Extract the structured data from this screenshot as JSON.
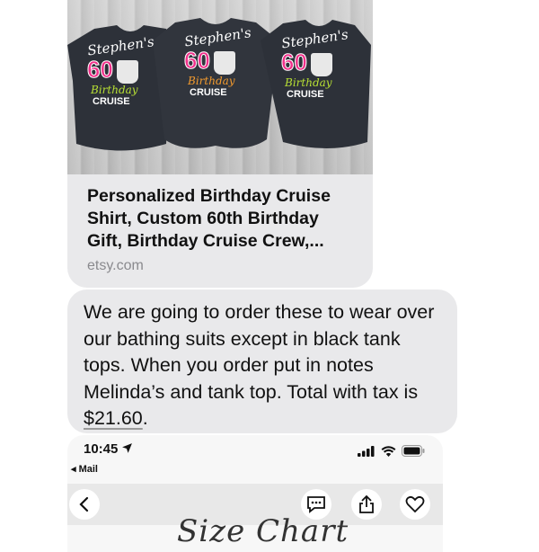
{
  "link_preview": {
    "image_shirt_text": {
      "name": "Stephen's",
      "number": "60",
      "word": "Birthday",
      "cruise": "CRUISE"
    },
    "title": "Personalized Birthday Cruise Shirt, Custom 60th Birthday Gift, Birthday Cruise Crew,...",
    "domain": "etsy.com"
  },
  "message": {
    "text_before_price": "We are going to order these to wear over our bathing suits except in black tank tops.  When you order put in notes Melinda’s and tank top.  Total with tax is ",
    "price": "$21.60",
    "text_after_price": "."
  },
  "embedded_screenshot": {
    "status_time": "10:45",
    "back_label": "◂ Mail",
    "icons": [
      "location-arrow-icon",
      "signal-icon",
      "wifi-icon",
      "battery-icon",
      "back-chevron-icon",
      "message-icon",
      "share-icon",
      "heart-icon"
    ],
    "partial_heading": "Size Chart"
  },
  "colors": {
    "bubble": "#e9e9eb",
    "shirt": "#2b2f36",
    "pink": "#f0308a",
    "lime": "#b8e034",
    "orange": "#f29a2e"
  }
}
